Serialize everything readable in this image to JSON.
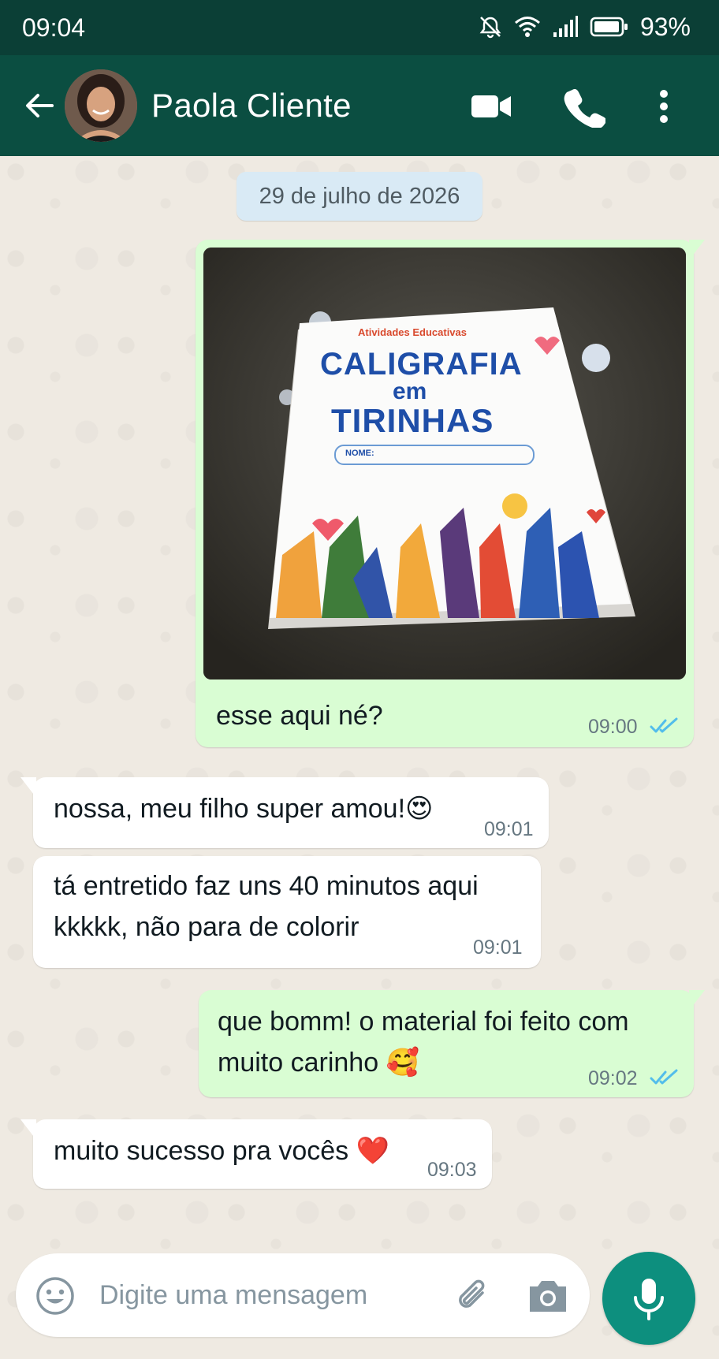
{
  "status_bar": {
    "time": "09:04",
    "battery_percent": "93%"
  },
  "header": {
    "contact_name": "Paola Cliente"
  },
  "chat": {
    "date_chip": "29 de julho de 2026",
    "messages": [
      {
        "direction": "outgoing",
        "type": "image",
        "caption": "esse aqui né?",
        "time": "09:00",
        "status": "read"
      },
      {
        "direction": "incoming",
        "text": "nossa, meu filho super amou!",
        "emoji": "😍",
        "time": "09:01"
      },
      {
        "direction": "incoming",
        "line1": "tá entretido faz uns 40 minutos aqui",
        "line2": "kkkkk, não para de colorir",
        "time": "09:01"
      },
      {
        "direction": "outgoing",
        "line1": "que bomm! o material foi feito com",
        "line2": "muito carinho",
        "emoji": "🥰",
        "time": "09:02",
        "status": "read"
      },
      {
        "direction": "incoming",
        "text": "muito sucesso pra vocês",
        "emoji": "❤️",
        "time": "09:03"
      }
    ]
  },
  "photo_cover": {
    "subtitle": "Atividades Educativas",
    "title_line1": "CALIGRAFIA",
    "title_line2": "em",
    "title_line3": "TIRINHAS",
    "name_label": "NOME:"
  },
  "composer": {
    "placeholder": "Digite uma mensagem"
  },
  "colors": {
    "header": "#0b4e41",
    "status_bar": "#0b3f36",
    "outgoing_bubble": "#d9fdd3",
    "incoming_bubble": "#ffffff",
    "read_tick": "#53bdeb",
    "mic_button": "#0d8f7e"
  },
  "icons": [
    "back-arrow-icon",
    "video-call-icon",
    "phone-icon",
    "more-vert-icon",
    "emoji-icon",
    "attach-icon",
    "camera-icon",
    "mic-icon",
    "wifi-icon",
    "signal-icon",
    "battery-icon",
    "mute-icon",
    "read-receipt-icon"
  ]
}
